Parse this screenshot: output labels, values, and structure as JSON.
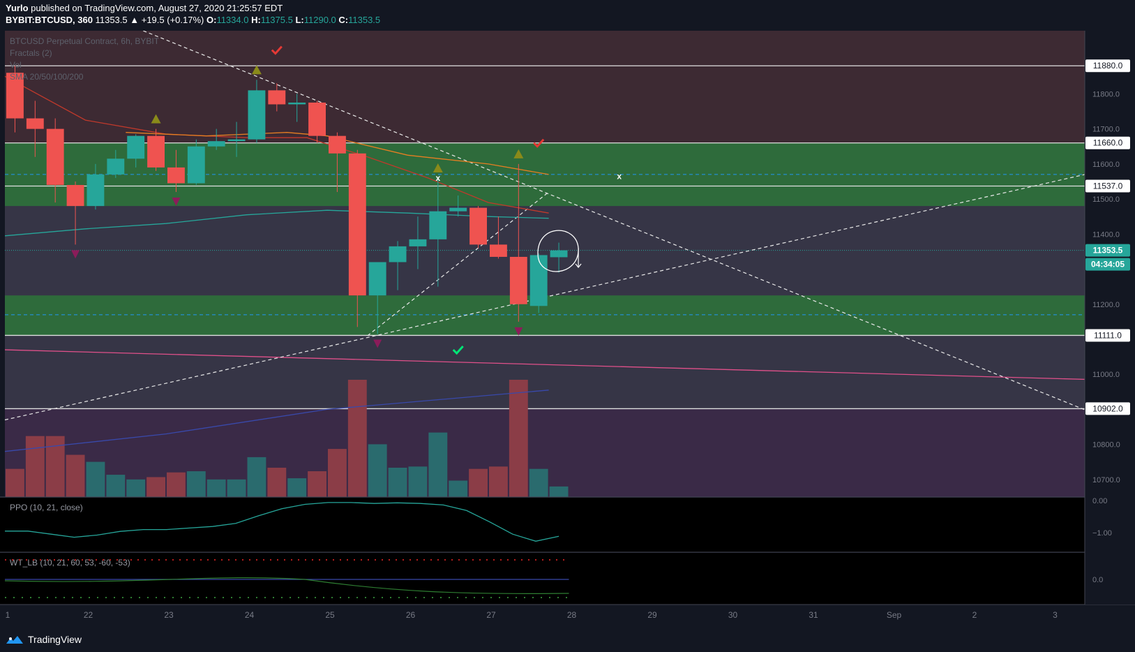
{
  "header": {
    "author": "Yurlo",
    "published_text": "published on TradingView.com, August 27, 2020 21:25:57 EDT",
    "symbol": "BYBIT:BTCUSD, 360",
    "last": "11353.5",
    "change": "▲ +19.5 (+0.17%)",
    "o_label": "O:",
    "o_value": "11334.0",
    "h_label": "H:",
    "h_value": "11375.5",
    "l_label": "L:",
    "l_value": "11290.0",
    "c_label": "C:",
    "c_value": "11353.5"
  },
  "legend": {
    "title": "BTCUSD Perpetual Contract, 6h, BYBIT",
    "fractals": "Fractals (2)",
    "vol": "Vol",
    "sma": "SMA 20/50/100/200"
  },
  "footer": {
    "brand": "TradingView"
  },
  "colors": {
    "up": "#26a69a",
    "down": "#ef5350",
    "background": "#131722",
    "zone_red": "#3d2a33",
    "zone_green": "#2e6b3b",
    "zone_purple": "#3a2a47",
    "price_tag": "#26a69a"
  },
  "chart_data": [
    {
      "type": "candlestick",
      "title": "BTCUSD Perpetual Contract, 6h, BYBIT",
      "timeframe": "6h",
      "y_scale": "price",
      "ylim": [
        10650,
        11980
      ],
      "y_ticks": [
        11800,
        11700,
        11600,
        11500,
        11400,
        11200,
        11000,
        10800,
        10700
      ],
      "x_ticks": [
        "1",
        "22",
        "23",
        "24",
        "25",
        "26",
        "27",
        "28",
        "29",
        "30",
        "31",
        "Sep",
        "2",
        "3"
      ],
      "date_ticks": [
        "2020-08-21",
        "2020-08-22",
        "2020-08-23",
        "2020-08-24",
        "2020-08-25",
        "2020-08-26",
        "2020-08-27",
        "2020-08-28",
        "2020-08-29",
        "2020-08-30",
        "2020-08-31",
        "2020-09-01",
        "2020-09-02",
        "2020-09-03"
      ],
      "xlim": [
        "2020-08-21",
        "2020-09-03T12:00"
      ],
      "candles": [
        {
          "t": "2020-08-21T00:00",
          "o": 11860,
          "h": 11880,
          "l": 11690,
          "c": 11730
        },
        {
          "t": "2020-08-21T06:00",
          "o": 11730,
          "h": 11780,
          "l": 11620,
          "c": 11700
        },
        {
          "t": "2020-08-21T12:00",
          "o": 11700,
          "h": 11730,
          "l": 11490,
          "c": 11540
        },
        {
          "t": "2020-08-21T18:00",
          "o": 11540,
          "h": 11550,
          "l": 11370,
          "c": 11480
        },
        {
          "t": "2020-08-22T00:00",
          "o": 11480,
          "h": 11600,
          "l": 11470,
          "c": 11570
        },
        {
          "t": "2020-08-22T06:00",
          "o": 11570,
          "h": 11640,
          "l": 11560,
          "c": 11615
        },
        {
          "t": "2020-08-22T12:00",
          "o": 11615,
          "h": 11685,
          "l": 11590,
          "c": 11680
        },
        {
          "t": "2020-08-22T18:00",
          "o": 11680,
          "h": 11700,
          "l": 11580,
          "c": 11590
        },
        {
          "t": "2020-08-23T00:00",
          "o": 11590,
          "h": 11640,
          "l": 11520,
          "c": 11545
        },
        {
          "t": "2020-08-23T06:00",
          "o": 11545,
          "h": 11670,
          "l": 11540,
          "c": 11650
        },
        {
          "t": "2020-08-23T12:00",
          "o": 11650,
          "h": 11700,
          "l": 11640,
          "c": 11665
        },
        {
          "t": "2020-08-23T18:00",
          "o": 11665,
          "h": 11720,
          "l": 11620,
          "c": 11670
        },
        {
          "t": "2020-08-24T00:00",
          "o": 11670,
          "h": 11840,
          "l": 11660,
          "c": 11810
        },
        {
          "t": "2020-08-24T06:00",
          "o": 11810,
          "h": 11830,
          "l": 11750,
          "c": 11770
        },
        {
          "t": "2020-08-24T12:00",
          "o": 11770,
          "h": 11800,
          "l": 11720,
          "c": 11775
        },
        {
          "t": "2020-08-24T18:00",
          "o": 11775,
          "h": 11780,
          "l": 11660,
          "c": 11680
        },
        {
          "t": "2020-08-25T00:00",
          "o": 11680,
          "h": 11690,
          "l": 11520,
          "c": 11630
        },
        {
          "t": "2020-08-25T06:00",
          "o": 11630,
          "h": 11640,
          "l": 11135,
          "c": 11225
        },
        {
          "t": "2020-08-25T12:00",
          "o": 11225,
          "h": 11320,
          "l": 11115,
          "c": 11320
        },
        {
          "t": "2020-08-25T18:00",
          "o": 11320,
          "h": 11380,
          "l": 11240,
          "c": 11365
        },
        {
          "t": "2020-08-26T00:00",
          "o": 11365,
          "h": 11450,
          "l": 11300,
          "c": 11385
        },
        {
          "t": "2020-08-26T06:00",
          "o": 11385,
          "h": 11560,
          "l": 11250,
          "c": 11465
        },
        {
          "t": "2020-08-26T12:00",
          "o": 11465,
          "h": 11510,
          "l": 11450,
          "c": 11475
        },
        {
          "t": "2020-08-26T18:00",
          "o": 11475,
          "h": 11480,
          "l": 11360,
          "c": 11370
        },
        {
          "t": "2020-08-27T00:00",
          "o": 11370,
          "h": 11450,
          "l": 11330,
          "c": 11335
        },
        {
          "t": "2020-08-27T06:00",
          "o": 11335,
          "h": 11600,
          "l": 11150,
          "c": 11200
        },
        {
          "t": "2020-08-27T12:00",
          "o": 11195,
          "h": 11345,
          "l": 11175,
          "c": 11340
        },
        {
          "t": "2020-08-27T18:00",
          "o": 11334,
          "h": 11375.5,
          "l": 11290,
          "c": 11353.5
        }
      ],
      "volume_bars": [
        {
          "t": "2020-08-21T00:00",
          "dir": "down",
          "rel": 0.24
        },
        {
          "t": "2020-08-21T06:00",
          "dir": "down",
          "rel": 0.52
        },
        {
          "t": "2020-08-21T12:00",
          "dir": "down",
          "rel": 0.52
        },
        {
          "t": "2020-08-21T18:00",
          "dir": "down",
          "rel": 0.36
        },
        {
          "t": "2020-08-22T00:00",
          "dir": "up",
          "rel": 0.3
        },
        {
          "t": "2020-08-22T06:00",
          "dir": "up",
          "rel": 0.19
        },
        {
          "t": "2020-08-22T12:00",
          "dir": "up",
          "rel": 0.15
        },
        {
          "t": "2020-08-22T18:00",
          "dir": "down",
          "rel": 0.17
        },
        {
          "t": "2020-08-23T00:00",
          "dir": "down",
          "rel": 0.21
        },
        {
          "t": "2020-08-23T06:00",
          "dir": "up",
          "rel": 0.22
        },
        {
          "t": "2020-08-23T12:00",
          "dir": "up",
          "rel": 0.15
        },
        {
          "t": "2020-08-23T18:00",
          "dir": "up",
          "rel": 0.15
        },
        {
          "t": "2020-08-24T00:00",
          "dir": "up",
          "rel": 0.34
        },
        {
          "t": "2020-08-24T06:00",
          "dir": "down",
          "rel": 0.25
        },
        {
          "t": "2020-08-24T12:00",
          "dir": "up",
          "rel": 0.16
        },
        {
          "t": "2020-08-24T18:00",
          "dir": "down",
          "rel": 0.22
        },
        {
          "t": "2020-08-25T00:00",
          "dir": "down",
          "rel": 0.41
        },
        {
          "t": "2020-08-25T06:00",
          "dir": "down",
          "rel": 1.0
        },
        {
          "t": "2020-08-25T12:00",
          "dir": "up",
          "rel": 0.45
        },
        {
          "t": "2020-08-25T18:00",
          "dir": "up",
          "rel": 0.25
        },
        {
          "t": "2020-08-26T00:00",
          "dir": "up",
          "rel": 0.26
        },
        {
          "t": "2020-08-26T06:00",
          "dir": "up",
          "rel": 0.55
        },
        {
          "t": "2020-08-26T12:00",
          "dir": "up",
          "rel": 0.14
        },
        {
          "t": "2020-08-26T18:00",
          "dir": "down",
          "rel": 0.24
        },
        {
          "t": "2020-08-27T00:00",
          "dir": "down",
          "rel": 0.26
        },
        {
          "t": "2020-08-27T06:00",
          "dir": "down",
          "rel": 1.0
        },
        {
          "t": "2020-08-27T12:00",
          "dir": "up",
          "rel": 0.24
        },
        {
          "t": "2020-08-27T18:00",
          "dir": "up",
          "rel": 0.09
        }
      ],
      "sma_lines": [
        {
          "name": "SMA 20",
          "color": "#c0392b",
          "points": [
            [
              "2020-08-21T00:00",
              11850
            ],
            [
              "2020-08-22T00:00",
              11725
            ],
            [
              "2020-08-23T00:00",
              11685
            ],
            [
              "2020-08-24T00:00",
              11675
            ],
            [
              "2020-08-24T18:00",
              11675
            ],
            [
              "2020-08-25T12:00",
              11620
            ],
            [
              "2020-08-26T06:00",
              11560
            ],
            [
              "2020-08-27T00:00",
              11490
            ],
            [
              "2020-08-27T18:00",
              11460
            ]
          ]
        },
        {
          "name": "SMA 50",
          "color": "#e67e22",
          "points": [
            [
              "2020-08-22T12:00",
              11690
            ],
            [
              "2020-08-23T12:00",
              11680
            ],
            [
              "2020-08-24T12:00",
              11690
            ],
            [
              "2020-08-25T00:00",
              11680
            ],
            [
              "2020-08-26T00:00",
              11625
            ],
            [
              "2020-08-27T00:00",
              11600
            ],
            [
              "2020-08-27T18:00",
              11570
            ]
          ]
        },
        {
          "name": "SMA 100",
          "color": "#26a69a",
          "points": [
            [
              "2020-08-21T00:00",
              11395
            ],
            [
              "2020-08-22T00:00",
              11415
            ],
            [
              "2020-08-23T00:00",
              11430
            ],
            [
              "2020-08-24T00:00",
              11455
            ],
            [
              "2020-08-25T00:00",
              11468
            ],
            [
              "2020-08-26T00:00",
              11460
            ],
            [
              "2020-08-27T00:00",
              11450
            ],
            [
              "2020-08-27T18:00",
              11445
            ]
          ]
        },
        {
          "name": "SMA 200",
          "color": "#3949ab",
          "points": [
            [
              "2020-08-21T00:00",
              10780
            ],
            [
              "2020-08-23T00:00",
              10830
            ],
            [
              "2020-08-25T00:00",
              10900
            ],
            [
              "2020-08-27T18:00",
              10955
            ]
          ]
        }
      ],
      "horizontal_levels": [
        11880.0,
        11660.0,
        11537.0,
        11111.0,
        10902.0
      ],
      "zones": [
        {
          "from": 11660,
          "to": 11980,
          "color": "red"
        },
        {
          "from": 11480,
          "to": 11660,
          "color": "green"
        },
        {
          "from": 11111,
          "to": 11225,
          "color": "green"
        },
        {
          "from": 10650,
          "to": 10902,
          "color": "purple"
        }
      ],
      "dashed_levels": [
        11570,
        11170
      ],
      "current_price_line": 11353.5,
      "price_labels": [
        "11880.0",
        "11660.0",
        "11537.0",
        "11353.5",
        "04:34:05",
        "11111.0",
        "10902.0"
      ],
      "pink_trendline": [
        [
          "2020-08-21T00:00",
          11070
        ],
        [
          "2020-09-03T12:00",
          10985
        ]
      ],
      "dashed_trendlines": [
        [
          [
            "2020-08-22T12:00",
            12000
          ],
          [
            "2020-09-03T12:00",
            10890
          ]
        ],
        [
          [
            "2020-08-21T00:00",
            10870
          ],
          [
            "2020-09-03T12:00",
            11575
          ]
        ],
        [
          [
            "2020-08-25T12:00",
            11110
          ],
          [
            "2020-08-27T18:00",
            11520
          ]
        ]
      ],
      "fractal_up": [
        "2020-08-22T18:00",
        "2020-08-24T00:00",
        "2020-08-26T06:00",
        "2020-08-27T06:00"
      ],
      "fractal_down": [
        "2020-08-21T18:00",
        "2020-08-23T00:00",
        "2020-08-25T12:00",
        "2020-08-27T06:00"
      ],
      "x_marks": [
        [
          "2020-08-26T06:00",
          11560
        ],
        [
          "2020-08-28T12:00",
          11565
        ]
      ],
      "check_marks": [
        {
          "t": "2020-08-24T06:00",
          "price": 11925,
          "color": "red"
        },
        {
          "t": "2020-08-27T12:00",
          "price": 11660,
          "color": "red"
        },
        {
          "t": "2020-08-26T12:00",
          "price": 11070,
          "color": "green"
        }
      ]
    },
    {
      "type": "line",
      "title": "PPO (10, 21, close)",
      "y_ticks": [
        "0.00",
        "−1.00"
      ],
      "ylim": [
        -1.5,
        0.0
      ],
      "series": [
        {
          "values": [
            -0.95,
            -0.95,
            -1.05,
            -1.15,
            -1.08,
            -0.96,
            -0.9,
            -0.9,
            -0.85,
            -0.8,
            -0.7,
            -0.45,
            -0.22,
            -0.08,
            -0.02,
            -0.02,
            -0.05,
            -0.03,
            -0.05,
            -0.1,
            -0.28,
            -0.65,
            -1.05,
            -1.28,
            -1.12
          ]
        }
      ]
    },
    {
      "type": "line",
      "title": "WT_LB (10, 21, 60, 53, -60, -53)",
      "y_ticks": [
        "0.0"
      ],
      "series": [
        {
          "values": [
            0.0,
            0.0,
            0.0,
            0.0,
            0.0,
            0.0,
            0.0,
            0.0,
            0.0,
            0.0,
            0.0,
            0.0,
            0.0,
            0.0,
            0.0,
            0.0,
            0.0,
            0.0,
            0.0,
            0.0,
            0.0,
            0.0,
            0.0,
            0.0,
            0.0
          ]
        }
      ]
    }
  ]
}
